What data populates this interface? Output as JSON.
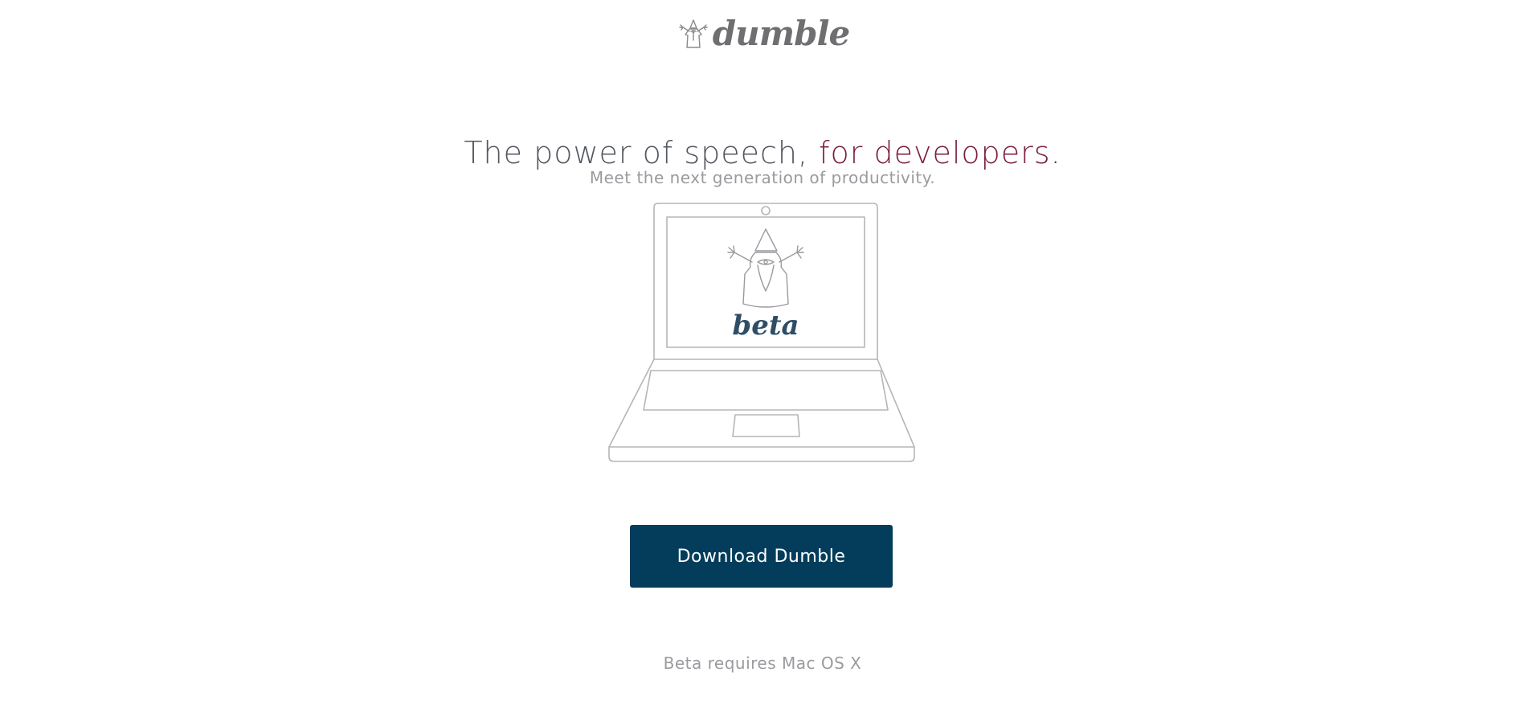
{
  "brand": {
    "logo_icon": "wizard-icon",
    "name": "dumble"
  },
  "hero": {
    "headline_main": "The power of speech, ",
    "headline_accent": "for developers.",
    "subheadline": "Meet the next generation of productivity."
  },
  "illustration": {
    "screen_label": "beta",
    "icon": "wizard-icon"
  },
  "cta": {
    "download_label": "Download Dumble",
    "requirement_note": "Beta requires Mac OS X"
  },
  "colors": {
    "background": "#ffffff",
    "headline": "#545661",
    "accent": "#7a1f3d",
    "muted_text": "#9a9a9f",
    "button": "#033d5b",
    "beta_label": "#2f4e66",
    "outline": "#b5b5b5"
  }
}
